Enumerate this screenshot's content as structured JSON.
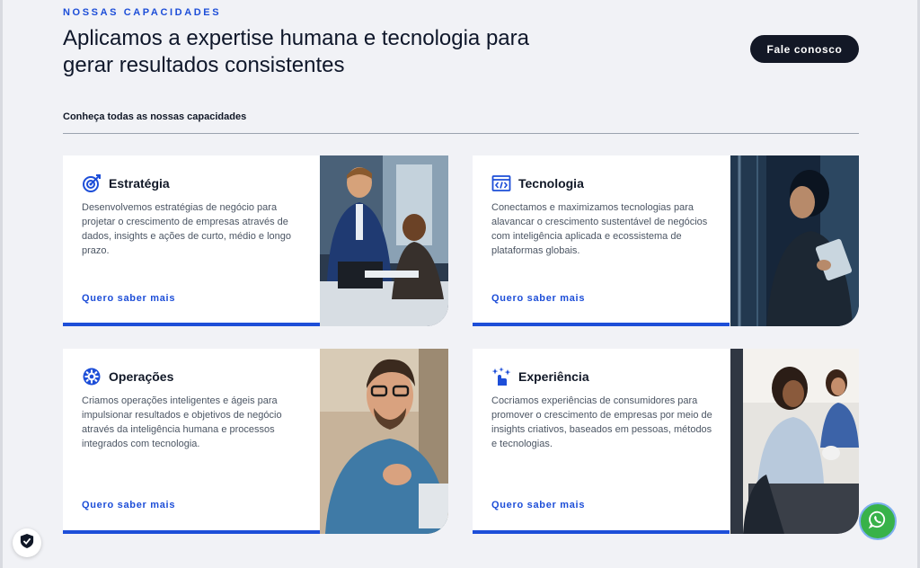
{
  "header": {
    "eyebrow": "NOSSAS CAPACIDADES",
    "headline": "Aplicamos a expertise humana e tecnologia para gerar resultados consistentes",
    "cta_label": "Fale conosco"
  },
  "section": {
    "subheading": "Conheça todas as nossas capacidades"
  },
  "cards": [
    {
      "icon": "target-icon",
      "title": "Estratégia",
      "description": "Desenvolvemos estratégias de negócio para projetar o crescimento de empresas através de dados, insights e ações de curto, médio e longo prazo.",
      "link_label": "Quero saber mais"
    },
    {
      "icon": "code-window-icon",
      "title": "Tecnologia",
      "description": "Conectamos e maximizamos tecnologias para alavancar o crescimento sustentável de negócios com inteligência aplicada e ecossistema de plataformas globais.",
      "link_label": "Quero saber mais"
    },
    {
      "icon": "gear-icon",
      "title": "Operações",
      "description": "Criamos operações inteligentes e ágeis para impulsionar resultados e objetivos de negócio através da inteligência humana e processos integrados com tecnologia.",
      "link_label": "Quero saber mais"
    },
    {
      "icon": "hand-stars-icon",
      "title": "Experiência",
      "description": "Cocriamos experiências de consumidores para promover o crescimento de empresas por meio de insights criativos, baseados em pessoas, métodos e tecnologias.",
      "link_label": "Quero saber mais"
    }
  ],
  "floating": {
    "privacy_icon": "shield-check-icon",
    "chat_icon": "whatsapp-icon"
  },
  "colors": {
    "accent": "#1d4ed8",
    "cta_bg": "#131826",
    "page_bg": "#f1f2f6",
    "whatsapp": "#38b24a"
  }
}
